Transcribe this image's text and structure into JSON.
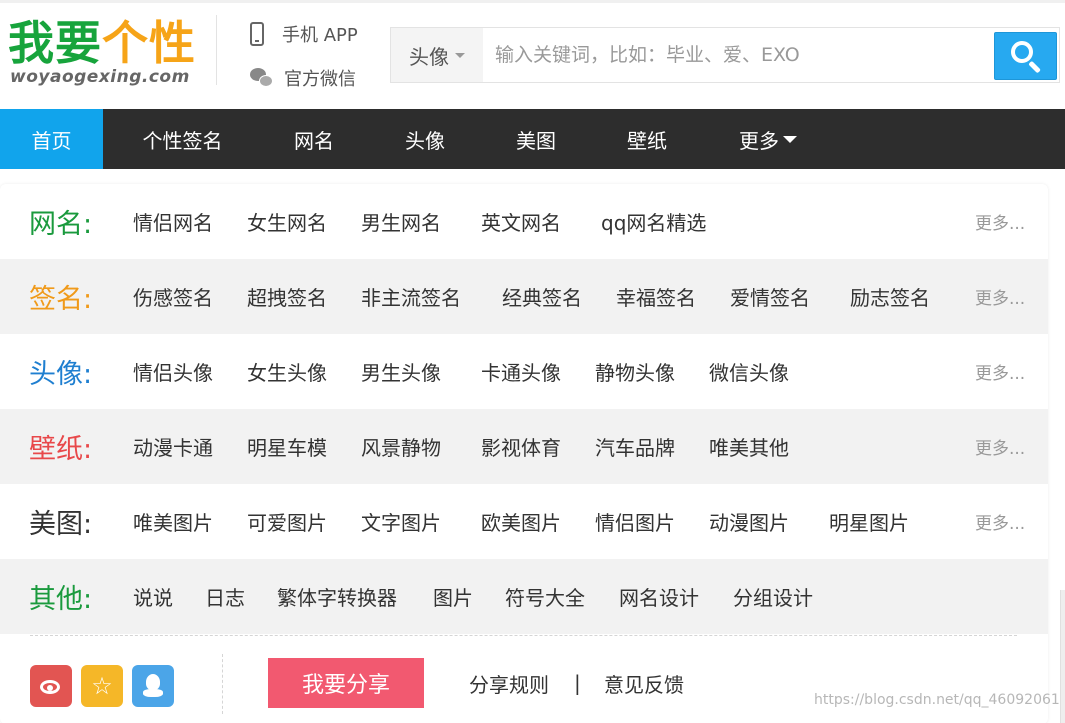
{
  "header": {
    "logo_part1": "我要",
    "logo_part2": "个性",
    "logo_url": "woyaogexing.com",
    "app_link": "手机 APP",
    "wechat_link": "官方微信"
  },
  "search": {
    "category": "头像",
    "placeholder": "输入关键词，比如：毕业、爱、EXO"
  },
  "nav": {
    "items": [
      "首页",
      "个性签名",
      "网名",
      "头像",
      "美图",
      "壁纸",
      "更多"
    ]
  },
  "categories": [
    {
      "label": "网名:",
      "color": "#1a9a3d",
      "links": [
        "情侣网名",
        "女生网名",
        "男生网名",
        "英文网名",
        "qq网名精选"
      ],
      "more": "更多..."
    },
    {
      "label": "签名:",
      "color": "#f09a1a",
      "links": [
        "伤感签名",
        "超拽签名",
        "非主流签名",
        "经典签名",
        "幸福签名",
        "爱情签名",
        "励志签名"
      ],
      "more": "更多..."
    },
    {
      "label": "头像:",
      "color": "#1f7fd0",
      "links": [
        "情侣头像",
        "女生头像",
        "男生头像",
        "卡通头像",
        "静物头像",
        "微信头像"
      ],
      "more": "更多..."
    },
    {
      "label": "壁纸:",
      "color": "#e8484a",
      "links": [
        "动漫卡通",
        "明星车模",
        "风景静物",
        "影视体育",
        "汽车品牌",
        "唯美其他"
      ],
      "more": "更多..."
    },
    {
      "label": "美图:",
      "color": "#333333",
      "links": [
        "唯美图片",
        "可爱图片",
        "文字图片",
        "欧美图片",
        "情侣图片",
        "动漫图片",
        "明星图片"
      ],
      "more": "更多..."
    },
    {
      "label": "其他:",
      "color": "#1a9a3d",
      "links": [
        "说说",
        "日志",
        "繁体字转换器",
        "图片",
        "符号大全",
        "网名设计",
        "分组设计"
      ]
    }
  ],
  "footer": {
    "share_button": "我要分享",
    "share_rules": "分享规则",
    "separator": "|",
    "feedback": "意见反馈",
    "watermark": "https://blog.csdn.net/qq_46092061"
  }
}
